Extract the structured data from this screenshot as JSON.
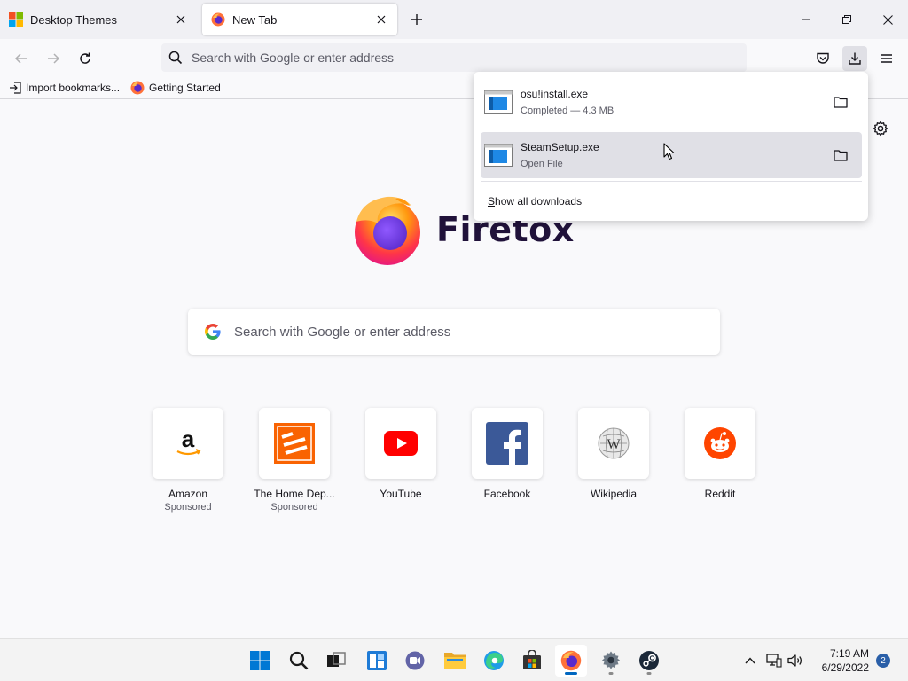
{
  "tabs": [
    {
      "title": "Desktop Themes",
      "icon": "windows-logo-icon",
      "active": false
    },
    {
      "title": "New Tab",
      "icon": "firefox-icon",
      "active": true
    }
  ],
  "navbar": {
    "url_placeholder": "Search with Google or enter address"
  },
  "bookmarks": [
    {
      "label": "Import bookmarks...",
      "icon": "import-icon"
    },
    {
      "label": "Getting Started",
      "icon": "firefox-icon"
    }
  ],
  "brand": {
    "name": "Firetox"
  },
  "search": {
    "placeholder": "Search with Google or enter address"
  },
  "top_sites": [
    {
      "label": "Amazon",
      "sponsor": "Sponsored",
      "icon": "amazon-icon"
    },
    {
      "label": "The Home Dep...",
      "sponsor": "Sponsored",
      "icon": "home-depot-icon"
    },
    {
      "label": "YouTube",
      "sponsor": "",
      "icon": "youtube-icon"
    },
    {
      "label": "Facebook",
      "sponsor": "",
      "icon": "facebook-icon"
    },
    {
      "label": "Wikipedia",
      "sponsor": "",
      "icon": "wikipedia-icon"
    },
    {
      "label": "Reddit",
      "sponsor": "",
      "icon": "reddit-icon"
    }
  ],
  "downloads": {
    "items": [
      {
        "name": "osu!install.exe",
        "status": "Completed — 4.3 MB"
      },
      {
        "name": "SteamSetup.exe",
        "status": "Open File"
      }
    ],
    "show_all_prefix": "S",
    "show_all_rest": "how all downloads"
  },
  "taskbar": {
    "apps": [
      "start-icon",
      "search-icon",
      "task-view-icon",
      "widgets-icon",
      "chat-icon",
      "file-explorer-icon",
      "edge-icon",
      "store-icon",
      "firefox-icon",
      "settings-icon",
      "steam-icon"
    ],
    "time": "7:19 AM",
    "date": "6/29/2022",
    "notification_count": "2"
  },
  "colors": {
    "accent": "#0060df",
    "firefox_orange": "#ff7139",
    "firefox_purple": "#592acb"
  }
}
